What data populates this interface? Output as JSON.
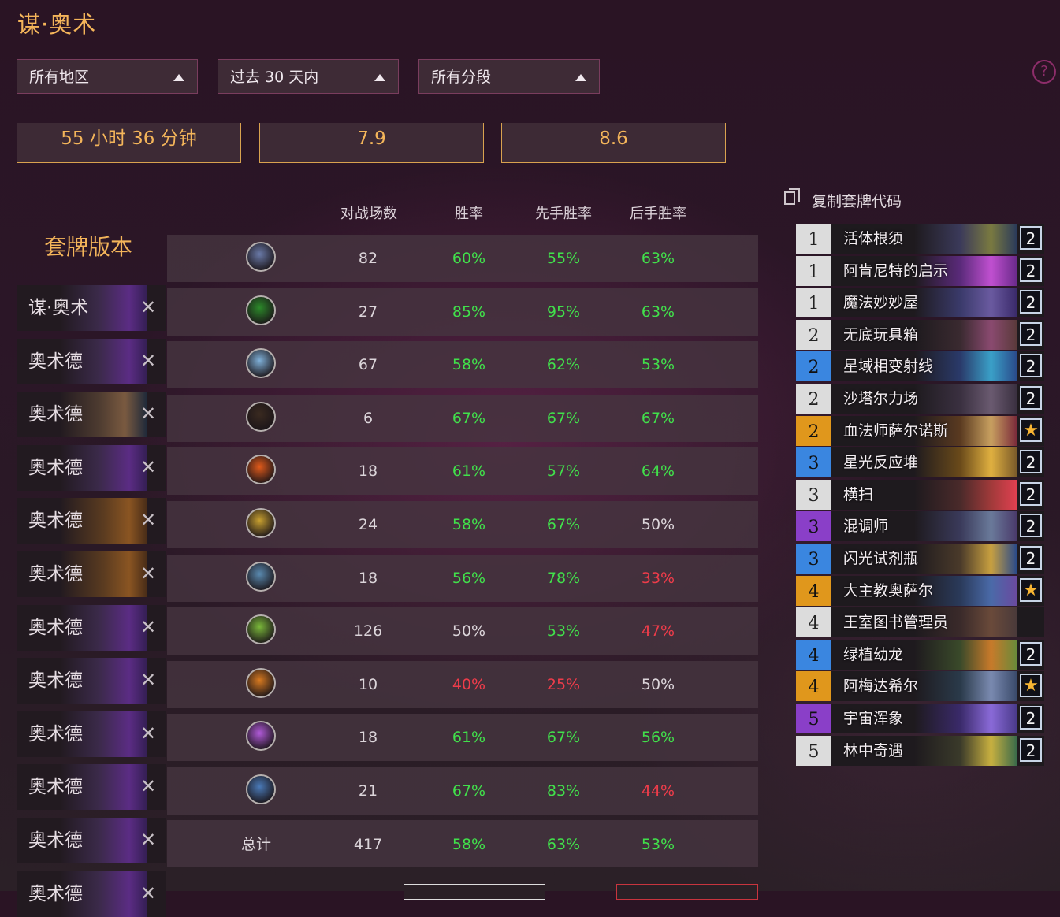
{
  "page_title": "谋·奥术",
  "filters": [
    {
      "label": "所有地区"
    },
    {
      "label": "过去 30 天内"
    },
    {
      "label": "所有分段"
    }
  ],
  "stats": [
    "55 小时 36 分钟",
    "7.9",
    "8.6"
  ],
  "table": {
    "section_title": "套牌版本",
    "headers": {
      "games": "对战场数",
      "winrate": "胜率",
      "first": "先手胜率",
      "second": "后手胜率"
    },
    "rows": [
      {
        "icon": "dueling-swords-icon",
        "games": "82",
        "winrate": "60%",
        "first": "55%",
        "second": "63%",
        "s": [
          "good",
          "good",
          "good"
        ]
      },
      {
        "icon": "fel-skull-icon",
        "games": "27",
        "winrate": "85%",
        "first": "95%",
        "second": "63%",
        "s": [
          "good",
          "good",
          "good"
        ]
      },
      {
        "icon": "fist-icon",
        "games": "67",
        "winrate": "58%",
        "first": "62%",
        "second": "53%",
        "s": [
          "good",
          "good",
          "good"
        ]
      },
      {
        "icon": "bow-icon",
        "games": "6",
        "winrate": "67%",
        "first": "67%",
        "second": "67%",
        "s": [
          "good",
          "good",
          "good"
        ]
      },
      {
        "icon": "fireball-icon",
        "games": "18",
        "winrate": "61%",
        "first": "57%",
        "second": "64%",
        "s": [
          "good",
          "good",
          "good"
        ]
      },
      {
        "icon": "holy-tome-icon",
        "games": "24",
        "winrate": "58%",
        "first": "67%",
        "second": "50%",
        "s": [
          "good",
          "good",
          "neutral"
        ]
      },
      {
        "icon": "totem-icon",
        "games": "18",
        "winrate": "56%",
        "first": "78%",
        "second": "33%",
        "s": [
          "good",
          "good",
          "bad"
        ]
      },
      {
        "icon": "nature-icon",
        "games": "126",
        "winrate": "50%",
        "first": "53%",
        "second": "47%",
        "s": [
          "neutral",
          "good",
          "bad"
        ]
      },
      {
        "icon": "demon-face-icon",
        "games": "10",
        "winrate": "40%",
        "first": "25%",
        "second": "50%",
        "s": [
          "bad",
          "bad",
          "neutral"
        ]
      },
      {
        "icon": "arcane-star-icon",
        "games": "18",
        "winrate": "61%",
        "first": "67%",
        "second": "56%",
        "s": [
          "good",
          "good",
          "good"
        ]
      },
      {
        "icon": "sword-icon",
        "games": "21",
        "winrate": "67%",
        "first": "83%",
        "second": "44%",
        "s": [
          "good",
          "good",
          "bad"
        ]
      }
    ],
    "total": {
      "label": "总计",
      "games": "417",
      "winrate": "58%",
      "first": "63%",
      "second": "53%",
      "s": [
        "good",
        "good",
        "good"
      ]
    }
  },
  "deck_versions": [
    {
      "name": "谋·奥术",
      "art": "purple"
    },
    {
      "name": "奥术德",
      "art": "purple"
    },
    {
      "name": "奥术德",
      "art": "face"
    },
    {
      "name": "奥术德",
      "art": "purple"
    },
    {
      "name": "奥术德",
      "art": "warm"
    },
    {
      "name": "奥术德",
      "art": "warm"
    },
    {
      "name": "奥术德",
      "art": "purple"
    },
    {
      "name": "奥术德",
      "art": "purple"
    },
    {
      "name": "奥术德",
      "art": "purple"
    },
    {
      "name": "奥术德",
      "art": "purple"
    },
    {
      "name": "奥术德",
      "art": "purple"
    },
    {
      "name": "奥术德",
      "art": "purple"
    }
  ],
  "copy_deck_label": "复制套牌代码",
  "cards": [
    {
      "cost": "1",
      "name": "活体根须",
      "count": "2",
      "rarity": "common"
    },
    {
      "cost": "1",
      "name": "阿肯尼特的启示",
      "count": "2",
      "rarity": "common"
    },
    {
      "cost": "1",
      "name": "魔法妙妙屋",
      "count": "2",
      "rarity": "common"
    },
    {
      "cost": "2",
      "name": "无底玩具箱",
      "count": "2",
      "rarity": "common"
    },
    {
      "cost": "2",
      "name": "星域相变射线",
      "count": "2",
      "rarity": "rare"
    },
    {
      "cost": "2",
      "name": "沙塔尔力场",
      "count": "2",
      "rarity": "common"
    },
    {
      "cost": "2",
      "name": "血法师萨尔诺斯",
      "count": "★",
      "rarity": "legendary"
    },
    {
      "cost": "3",
      "name": "星光反应堆",
      "count": "2",
      "rarity": "rare"
    },
    {
      "cost": "3",
      "name": "横扫",
      "count": "2",
      "rarity": "common"
    },
    {
      "cost": "3",
      "name": "混调师",
      "count": "2",
      "rarity": "epic"
    },
    {
      "cost": "3",
      "name": "闪光试剂瓶",
      "count": "2",
      "rarity": "rare"
    },
    {
      "cost": "4",
      "name": "大主教奥萨尔",
      "count": "★",
      "rarity": "legendary"
    },
    {
      "cost": "4",
      "name": "王室图书管理员",
      "count": "",
      "rarity": "common"
    },
    {
      "cost": "4",
      "name": "绿植幼龙",
      "count": "2",
      "rarity": "rare"
    },
    {
      "cost": "4",
      "name": "阿梅达希尔",
      "count": "★",
      "rarity": "legendary"
    },
    {
      "cost": "5",
      "name": "宇宙浑象",
      "count": "2",
      "rarity": "epic"
    },
    {
      "cost": "5",
      "name": "林中奇遇",
      "count": "2",
      "rarity": "common"
    }
  ],
  "colors": {
    "accent": "#f4b55a",
    "good": "#41e04b",
    "bad": "#ee3c4a",
    "rarity_common": "#dcdcdc",
    "rarity_rare": "#3a86e0",
    "rarity_epic": "#8a3fc8",
    "rarity_legendary": "#e0971c"
  }
}
